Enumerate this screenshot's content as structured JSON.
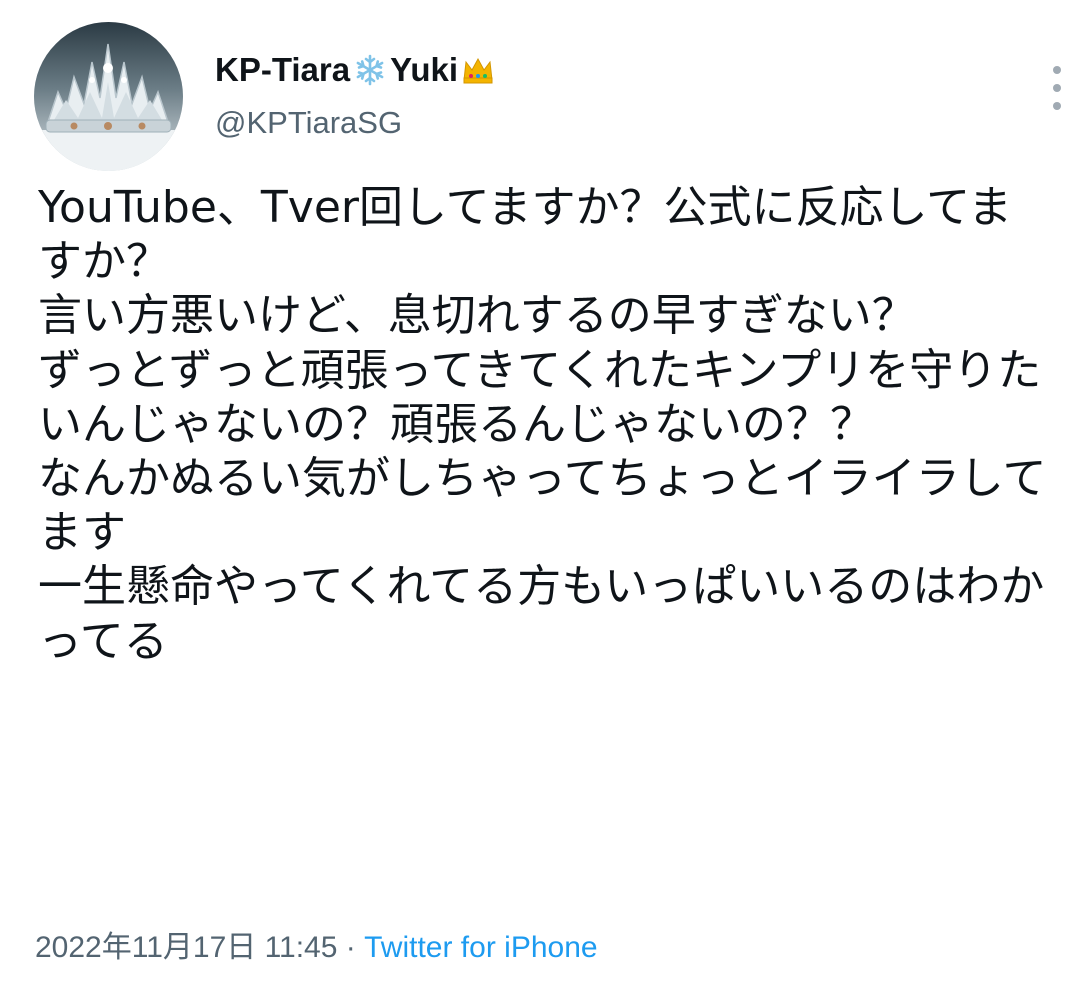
{
  "tweet": {
    "author": {
      "display_name_prefix": "KP-Tiara",
      "display_name_middle": "Yuki",
      "emoji_1": "snowflake-icon",
      "emoji_2": "crown-icon",
      "handle": "@KPTiaraSG"
    },
    "text": "YouTube、Tver回してますか？公式に反応してますか？\n言い方悪いけど、息切れするの早すぎない？\nずっとずっと頑張ってきてくれたキンプリを守りたいんじゃないの？頑張るんじゃないの？？\nなんかぬるい気がしちゃってちょっとイライラしてます\n一生懸命やってくれてる方もいっぱいいるのはわかってる",
    "timestamp": "2022年11月17日 11:45",
    "separator": "·",
    "source": "Twitter for iPhone"
  },
  "colors": {
    "text": "#0f1419",
    "secondary": "#536471",
    "link": "#1d9bf0",
    "snowflake": "#7fc3e8",
    "crown": "#f4b400"
  }
}
